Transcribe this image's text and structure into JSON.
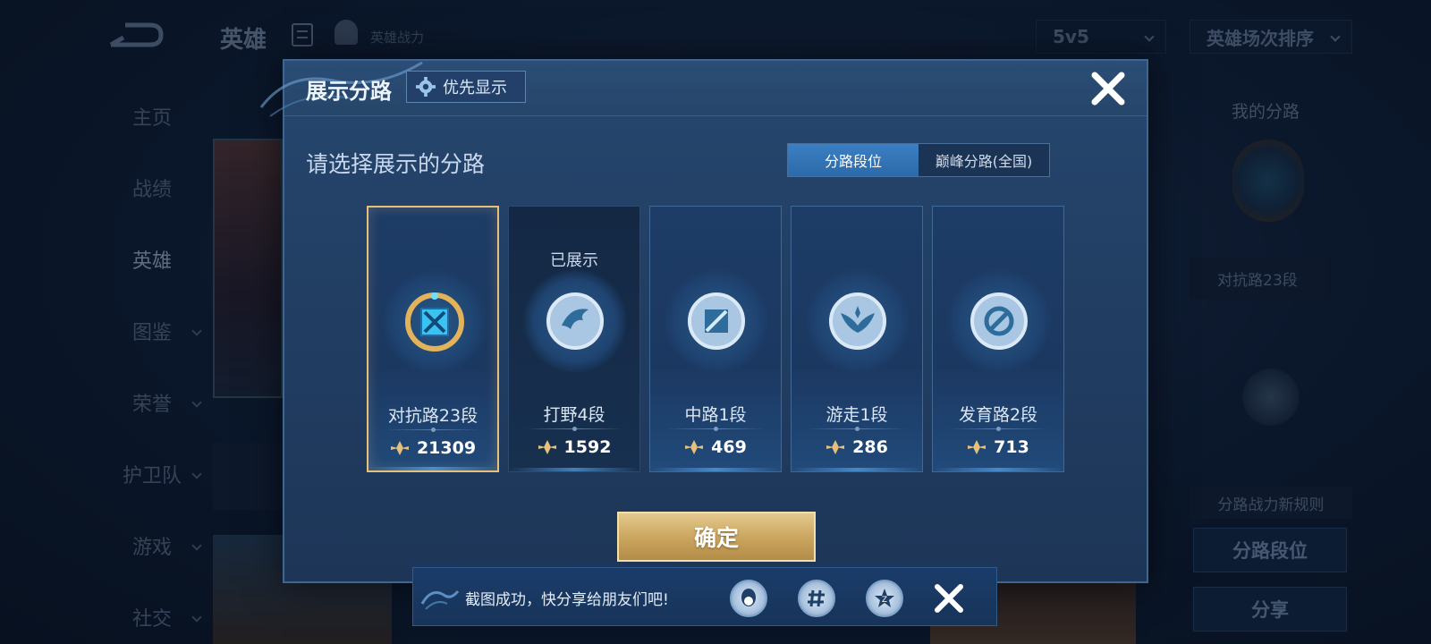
{
  "background": {
    "top_title": "英雄",
    "top_subtitle": "英雄战力",
    "mode_select": "5v5",
    "sort_select": "英雄场次排序",
    "nav_items": [
      {
        "label": "主页"
      },
      {
        "label": "战绩"
      },
      {
        "label": "英雄"
      },
      {
        "label": "图鉴"
      },
      {
        "label": "荣誉"
      },
      {
        "label": "护卫队"
      },
      {
        "label": "游戏"
      },
      {
        "label": "社交"
      }
    ],
    "right_panel": {
      "my_lanes_label": "我的分路",
      "lane_rank": "对抗路23段",
      "rule_label": "分路战力新规则",
      "lane_rank_button": "分路段位",
      "share_button": "分享"
    }
  },
  "modal": {
    "title": "展示分路",
    "priority_label": "优先显示",
    "prompt": "请选择展示的分路",
    "tabs": [
      {
        "label": "分路段位",
        "active": true
      },
      {
        "label": "巅峰分路(全国)",
        "active": false
      }
    ],
    "lanes": [
      {
        "name": "对抗路23段",
        "score": "21309",
        "selected": true,
        "shown_tag": "",
        "emblem": "clash-lane-gold-icon"
      },
      {
        "name": "打野4段",
        "score": "1592",
        "selected": false,
        "shown_tag": "已展示",
        "emblem": "jungle-dragon-icon"
      },
      {
        "name": "中路1段",
        "score": "469",
        "selected": false,
        "shown_tag": "",
        "emblem": "mid-lane-icon"
      },
      {
        "name": "游走1段",
        "score": "286",
        "selected": false,
        "shown_tag": "",
        "emblem": "roam-wings-icon"
      },
      {
        "name": "发育路2段",
        "score": "713",
        "selected": false,
        "shown_tag": "",
        "emblem": "farm-lane-icon"
      }
    ],
    "confirm_label": "确定"
  },
  "toast": {
    "message": "截图成功，快分享给朋友们吧!"
  },
  "colors": {
    "accent_gold": "#e6c07a",
    "tab_active": "#3a7fc4",
    "modal_bg": "#223f64"
  }
}
